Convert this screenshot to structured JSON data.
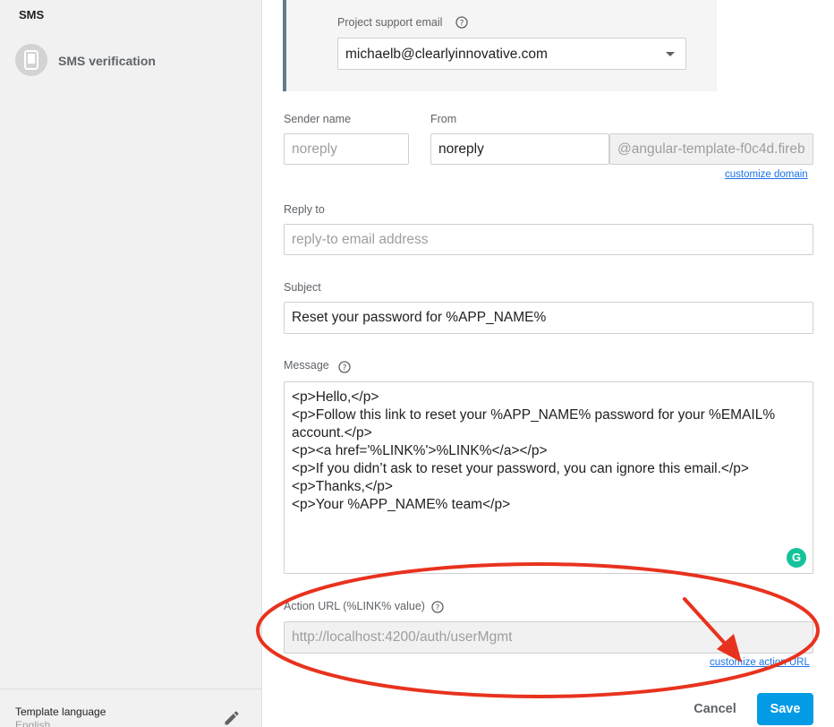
{
  "sidebar": {
    "section_title": "SMS",
    "items": [
      {
        "label": "SMS verification",
        "icon": "phone-icon"
      }
    ],
    "footer": {
      "label": "Template language",
      "value": "English"
    }
  },
  "support": {
    "label": "Project support email",
    "value": "michaelb@clearlyinnovative.com"
  },
  "sender_name": {
    "label": "Sender name",
    "placeholder": "noreply"
  },
  "from": {
    "label": "From",
    "value": "noreply",
    "domain": "@angular-template-f0c4d.fireb",
    "customize_domain": "customize domain"
  },
  "reply_to": {
    "label": "Reply to",
    "placeholder": "reply-to email address"
  },
  "subject": {
    "label": "Subject",
    "value": "Reset your password for %APP_NAME%"
  },
  "message": {
    "label": "Message",
    "lines": [
      "<p>Hello,</p>",
      "<p>Follow this link to reset your %APP_NAME% password for your %EMAIL%",
      "account.</p>",
      "<p><a href='%LINK%'>%LINK%</a></p>",
      "<p>If you didn’t ask to reset your password, you can ignore this email.</p>",
      "<p>Thanks,</p>",
      "<p>Your %APP_NAME% team</p>"
    ]
  },
  "action_url": {
    "label": "Action URL (%LINK% value)",
    "value": "http://localhost:4200/auth/userMgmt",
    "customize": "customize action URL"
  },
  "actions": {
    "cancel": "Cancel",
    "save": "Save"
  },
  "colors": {
    "accent": "#039be5",
    "link": "#1a73e8",
    "annotation": "#e8321e"
  }
}
